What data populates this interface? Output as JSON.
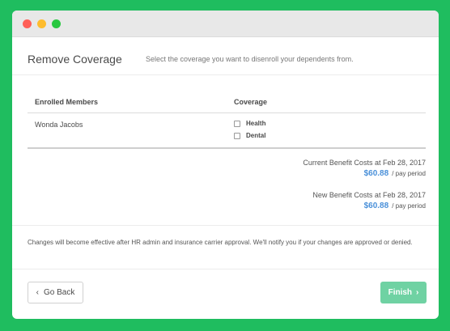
{
  "header": {
    "title": "Remove Coverage",
    "subtitle": "Select the coverage you want to disenroll your dependents from."
  },
  "table": {
    "columns": [
      "Enrolled Members",
      "Coverage"
    ],
    "rows": [
      {
        "member": "Wonda Jacobs",
        "coverage": [
          {
            "label": "Health",
            "checked": false
          },
          {
            "label": "Dental",
            "checked": false
          }
        ]
      }
    ]
  },
  "costs": {
    "current_label": "Current Benefit Costs at Feb 28, 2017",
    "current_amount": "$60.88",
    "new_label": "New Benefit Costs at Feb 28, 2017",
    "new_amount": "$60.88",
    "period": "/ pay period"
  },
  "notice": "Changes will become effective after HR admin and insurance carrier approval. We'll notify you if your changes are approved or denied.",
  "footer": {
    "back_label": "Go Back",
    "finish_label": "Finish"
  },
  "colors": {
    "background": "#1fbd5f",
    "accent_blue": "#4a90d9",
    "finish_button": "#6fd2a3"
  },
  "icons": {
    "back": "chevron-left-icon",
    "finish": "chevron-right-icon"
  }
}
